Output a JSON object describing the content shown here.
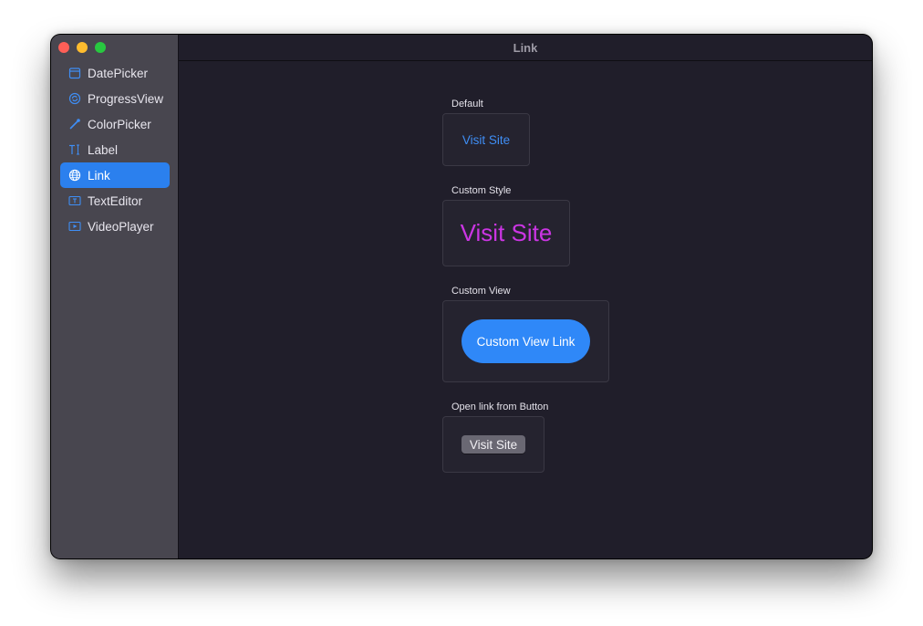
{
  "window": {
    "title": "Link"
  },
  "sidebar": {
    "items": [
      {
        "label": "DatePicker",
        "icon": "calendar-icon"
      },
      {
        "label": "ProgressView",
        "icon": "progress-icon"
      },
      {
        "label": "ColorPicker",
        "icon": "eyedropper-icon"
      },
      {
        "label": "Label",
        "icon": "text-cursor-icon"
      },
      {
        "label": "Link",
        "icon": "globe-icon",
        "selected": true
      },
      {
        "label": "TextEditor",
        "icon": "textbox-icon"
      },
      {
        "label": "VideoPlayer",
        "icon": "play-rectangle-icon"
      }
    ]
  },
  "sections": {
    "default": {
      "title": "Default",
      "link_text": "Visit Site"
    },
    "custom_style": {
      "title": "Custom Style",
      "link_text": "Visit Site"
    },
    "custom_view": {
      "title": "Custom View",
      "link_text": "Custom View Link"
    },
    "button": {
      "title": "Open link from Button",
      "button_text": "Visit Site"
    }
  },
  "colors": {
    "accent": "#2b80ee",
    "link_default": "#3f8ef5",
    "link_custom": "#cb35e3",
    "pill": "#2f88f8",
    "window_bg": "#201e2a",
    "sidebar_bg": "#48464f"
  }
}
